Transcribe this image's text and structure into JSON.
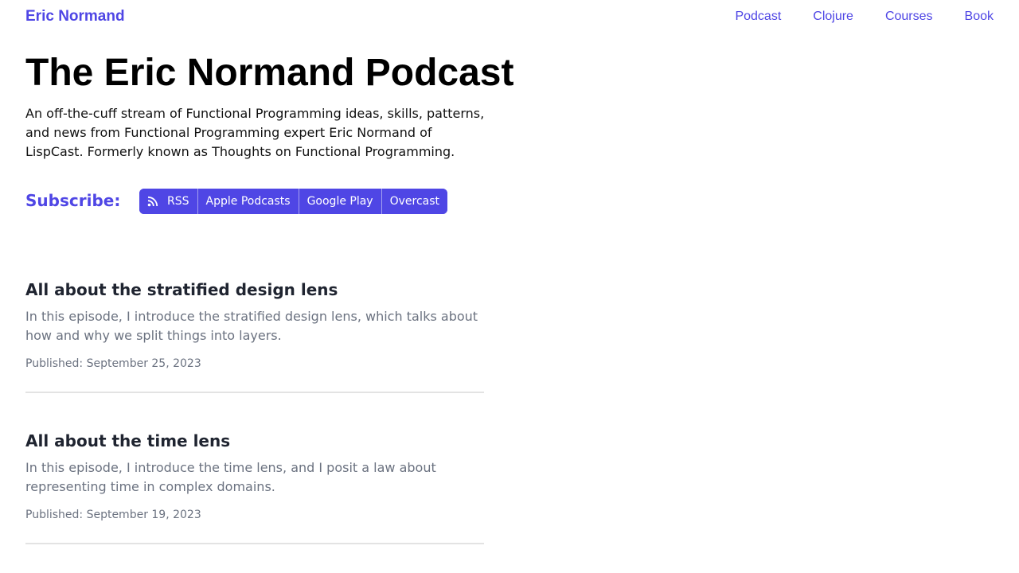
{
  "header": {
    "brand": "Eric Normand",
    "nav": [
      "Podcast",
      "Clojure",
      "Courses",
      "Book"
    ]
  },
  "page": {
    "title": "The Eric Normand Podcast",
    "description": "An off-the-cuff stream of Functional Programming ideas, skills, patterns, and news from Functional Programming expert Eric Normand of LispCast. Formerly known as Thoughts on Functional Programming."
  },
  "subscribe": {
    "label": "Subscribe:",
    "buttons": [
      {
        "label": "RSS",
        "icon": "rss-icon"
      },
      {
        "label": "Apple Podcasts"
      },
      {
        "label": "Google Play"
      },
      {
        "label": "Overcast"
      }
    ]
  },
  "episodes": [
    {
      "title": "All about the stratified design lens",
      "description": "In this episode, I introduce the stratified design lens, which talks about how and why we split things into layers.",
      "published": "Published: September 25, 2023"
    },
    {
      "title": "All about the time lens",
      "description": "In this episode, I introduce the time lens, and I posit a law about representing time in complex domains.",
      "published": "Published: September 19, 2023"
    }
  ],
  "colors": {
    "accent": "#4f46e5",
    "muted_text": "#6b7280",
    "divider": "#e3e3e3"
  }
}
